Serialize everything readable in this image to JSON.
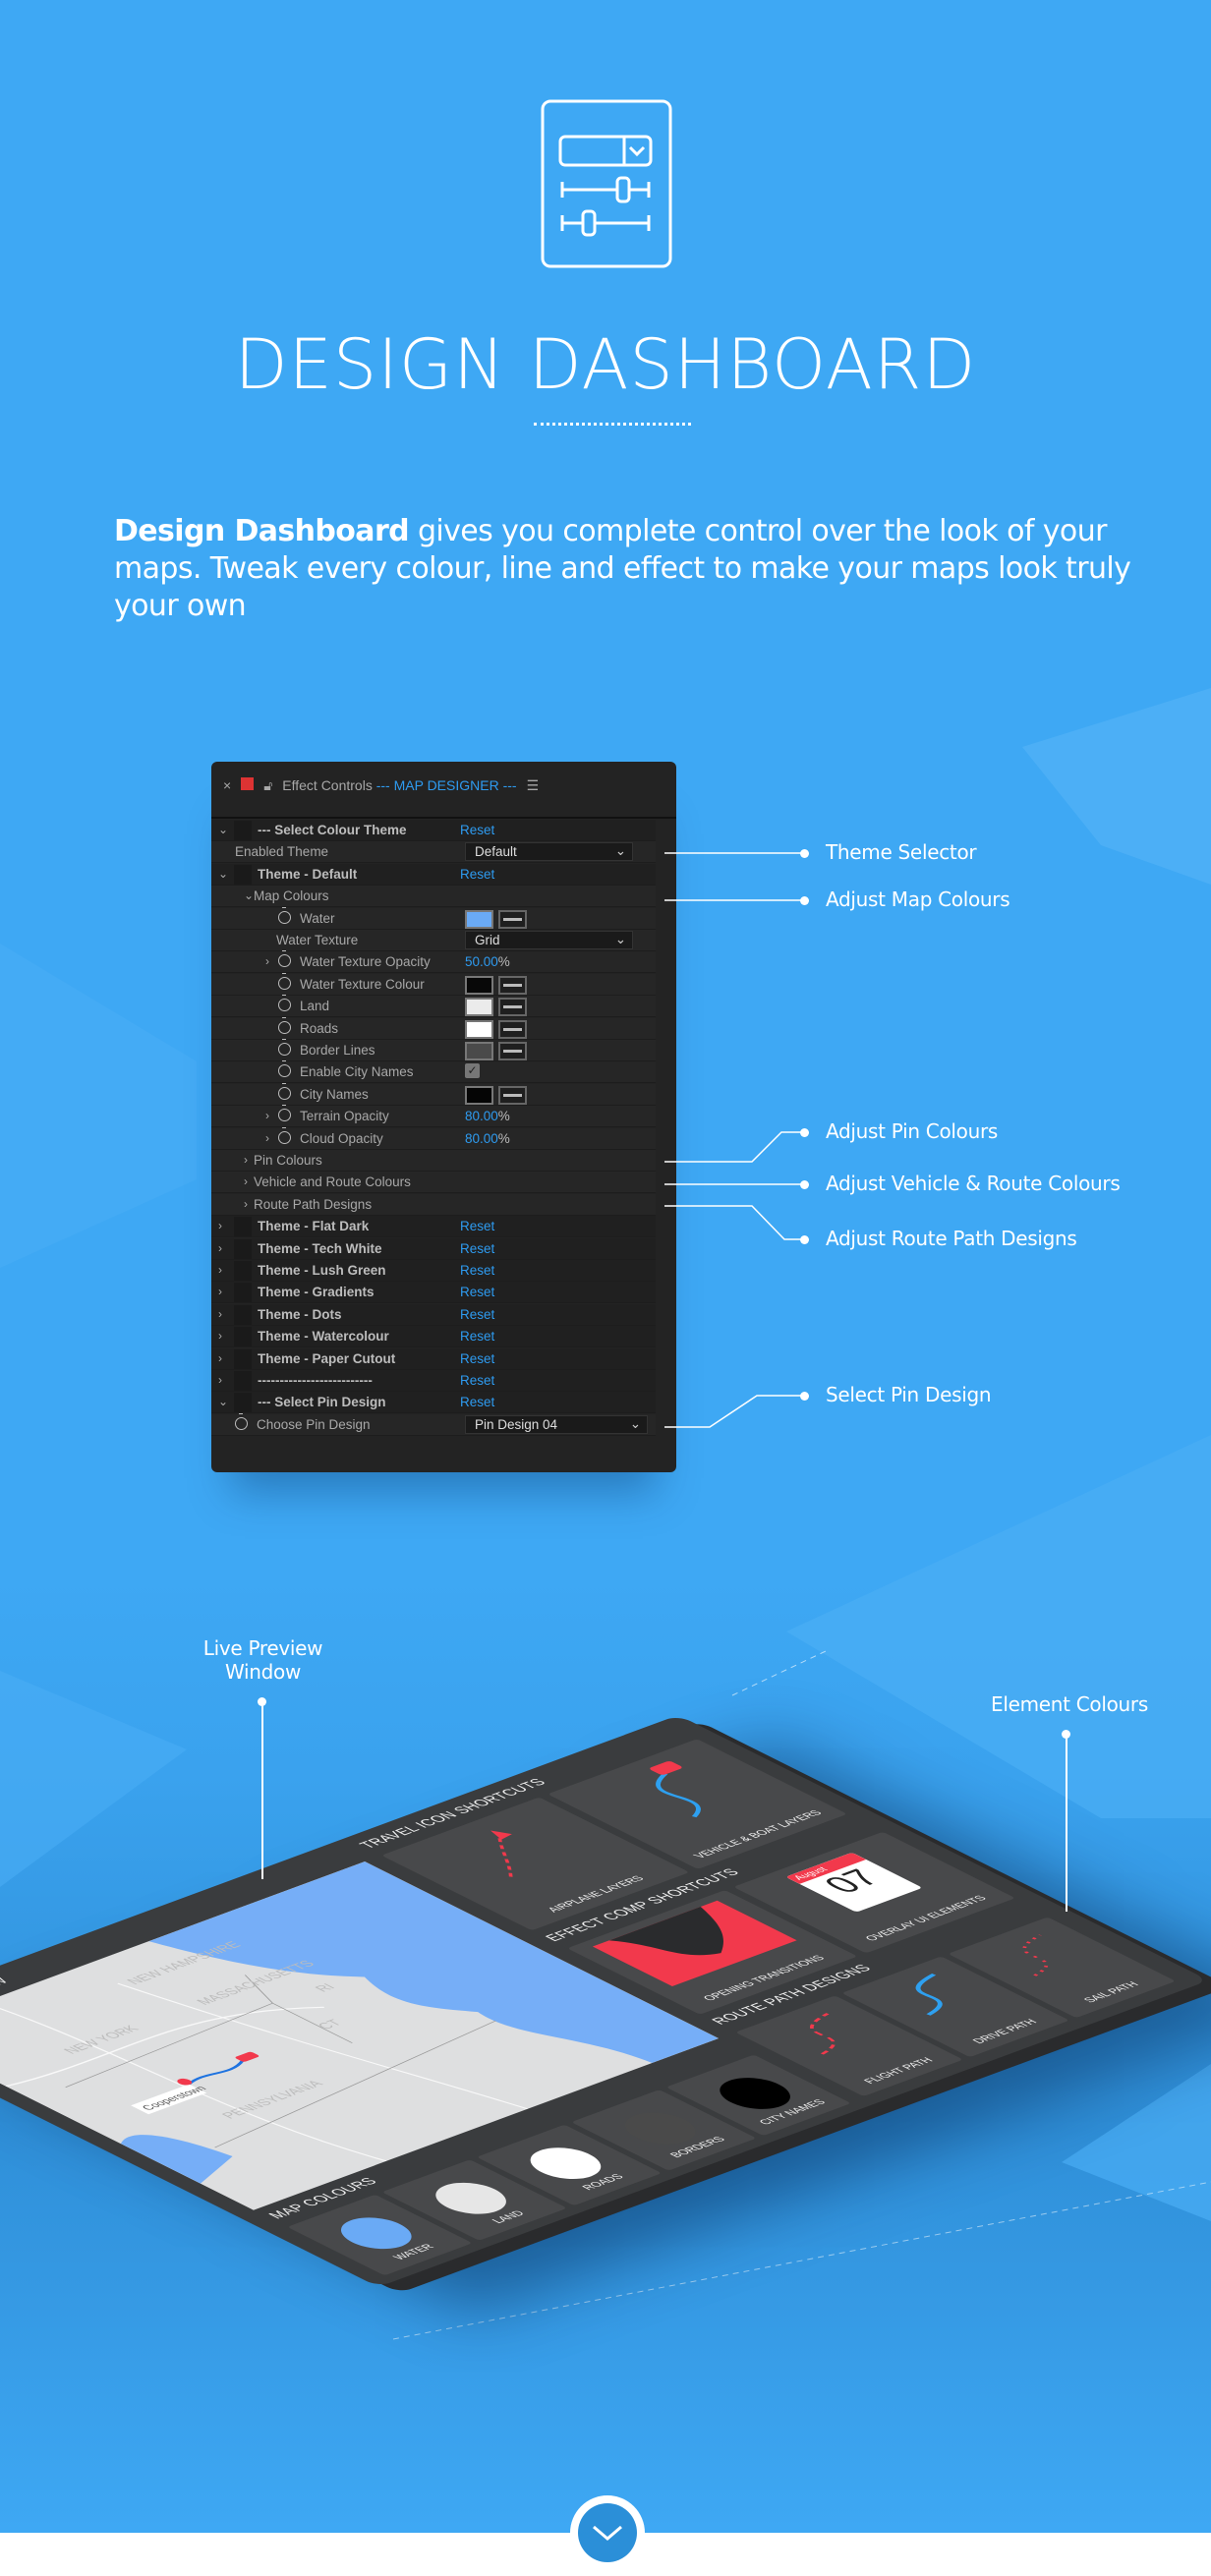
{
  "colors": {
    "background": "#3ea8f4",
    "accent": "#2e9bf0",
    "panel": "#232323",
    "pin_red": "#f2394c"
  },
  "header": {
    "icon": "dashboard-controls-icon",
    "title": "DESIGN DASHBOARD",
    "intro_bold": "Design Dashboard",
    "intro_rest": " gives you complete control over the look of your maps. Tweak every colour, line and effect to make your maps look truly your own"
  },
  "panel": {
    "title": "Effect Controls",
    "comp": "--- MAP DESIGNER ---",
    "rows": [
      {
        "kind": "section",
        "open": true,
        "label": "--- Select Colour Theme",
        "reset": "Reset"
      },
      {
        "kind": "prop",
        "x": 24,
        "label": "Enabled Theme",
        "value": {
          "type": "dropdown",
          "text": "Default"
        }
      },
      {
        "kind": "section",
        "open": true,
        "label": "Theme - Default",
        "reset": "Reset"
      },
      {
        "kind": "group",
        "open": true,
        "label": "Map Colours"
      },
      {
        "kind": "prop",
        "x": 90,
        "stopwatch": true,
        "label": "Water",
        "value": {
          "type": "color",
          "color": "#6aaaf5"
        }
      },
      {
        "kind": "prop",
        "x": 66,
        "label": "Water Texture",
        "value": {
          "type": "dropdown",
          "text": "Grid"
        }
      },
      {
        "kind": "prop",
        "x": 90,
        "stopwatch": true,
        "expander": true,
        "label": "Water Texture Opacity",
        "value": {
          "type": "percent",
          "number": "50.00",
          "unit": "%"
        }
      },
      {
        "kind": "prop",
        "x": 90,
        "stopwatch": true,
        "label": "Water Texture Colour",
        "value": {
          "type": "color",
          "color": "#080808"
        }
      },
      {
        "kind": "prop",
        "x": 90,
        "stopwatch": true,
        "label": "Land",
        "value": {
          "type": "color",
          "color": "#ebebeb"
        }
      },
      {
        "kind": "prop",
        "x": 90,
        "stopwatch": true,
        "label": "Roads",
        "value": {
          "type": "color",
          "color": "#ffffff"
        }
      },
      {
        "kind": "prop",
        "x": 90,
        "stopwatch": true,
        "label": "Border Lines",
        "value": {
          "type": "color",
          "color": "#4a4a4a"
        }
      },
      {
        "kind": "prop",
        "x": 90,
        "stopwatch": true,
        "label": "Enable City Names",
        "value": {
          "type": "checkbox",
          "checked": true
        }
      },
      {
        "kind": "prop",
        "x": 90,
        "stopwatch": true,
        "label": "City Names",
        "value": {
          "type": "color",
          "color": "#050505"
        }
      },
      {
        "kind": "prop",
        "x": 90,
        "stopwatch": true,
        "expander": true,
        "label": "Terrain Opacity",
        "value": {
          "type": "percent",
          "number": "80.00",
          "unit": "%"
        }
      },
      {
        "kind": "prop",
        "x": 90,
        "stopwatch": true,
        "expander": true,
        "label": "Cloud Opacity",
        "value": {
          "type": "percent",
          "number": "80.00",
          "unit": "%"
        }
      },
      {
        "kind": "group",
        "open": false,
        "label": "Pin Colours"
      },
      {
        "kind": "group",
        "open": false,
        "label": "Vehicle and Route Colours"
      },
      {
        "kind": "group",
        "open": false,
        "label": "Route Path Designs"
      },
      {
        "kind": "section",
        "open": false,
        "label": "Theme - Flat Dark",
        "reset": "Reset"
      },
      {
        "kind": "section",
        "open": false,
        "label": "Theme - Tech White",
        "reset": "Reset"
      },
      {
        "kind": "section",
        "open": false,
        "label": "Theme - Lush Green",
        "reset": "Reset"
      },
      {
        "kind": "section",
        "open": false,
        "label": "Theme - Gradients",
        "reset": "Reset"
      },
      {
        "kind": "section",
        "open": false,
        "label": "Theme - Dots",
        "reset": "Reset"
      },
      {
        "kind": "section",
        "open": false,
        "label": "Theme - Watercolour",
        "reset": "Reset"
      },
      {
        "kind": "section",
        "open": false,
        "label": "Theme - Paper Cutout",
        "reset": "Reset"
      },
      {
        "kind": "section",
        "open": false,
        "label": "--------------------------",
        "reset": "Reset"
      },
      {
        "kind": "section",
        "open": true,
        "label": "--- Select Pin Design",
        "reset": "Reset"
      },
      {
        "kind": "prop",
        "x": 46,
        "stopwatch": true,
        "label": "Choose Pin Design",
        "value": {
          "type": "dropdown",
          "text": "Pin Design 04",
          "wide": true
        }
      }
    ]
  },
  "callouts": [
    "Theme Selector",
    "Adjust Map Colours",
    "Adjust Pin Colours",
    "Adjust Vehicle & Route Colours",
    "Adjust Route Path Designs",
    "Select Pin Design"
  ],
  "tablet_callouts": {
    "live_preview_1": "Live Preview",
    "live_preview_2": "Window",
    "element_colours": "Element Colours"
  },
  "tablet": {
    "preview_title": "DESIGN PREVIEW",
    "map_labels": [
      "NEW YORK",
      "PENNSYLVANIA",
      "MASSACHUSETTS",
      "NEW HAMPSHIRE",
      "CT",
      "RI"
    ],
    "map_pin_label": "Cooperstown",
    "travel_title": "TRAVEL ICON SHORTCUTS",
    "travel_tiles": [
      "AIRPLANE LAYERS",
      "VEHICLE & BOAT LAYERS"
    ],
    "effect_title": "EFFECT COMP SHORTCUTS",
    "effect_tiles": [
      "OPENING TRANSITIONS",
      "OVERLAY UI ELEMENTS"
    ],
    "calendar_month": "August",
    "calendar_day": "07",
    "route_title": "ROUTE PATH DESIGNS",
    "route_tiles": [
      "FLIGHT PATH",
      "DRIVE PATH",
      "SAIL PATH"
    ],
    "colours_title": "MAP COLOURS",
    "colour_tiles": [
      {
        "label": "WATER",
        "color": "#6aaaf5"
      },
      {
        "label": "LAND",
        "color": "#e6e6e6"
      },
      {
        "label": "ROADS",
        "color": "#ffffff"
      },
      {
        "label": "BORDERS",
        "color": "#4a4a4a"
      },
      {
        "label": "CITY NAMES",
        "color": "#000000"
      }
    ]
  },
  "scroll_button": {
    "icon": "chevron-down-icon"
  }
}
